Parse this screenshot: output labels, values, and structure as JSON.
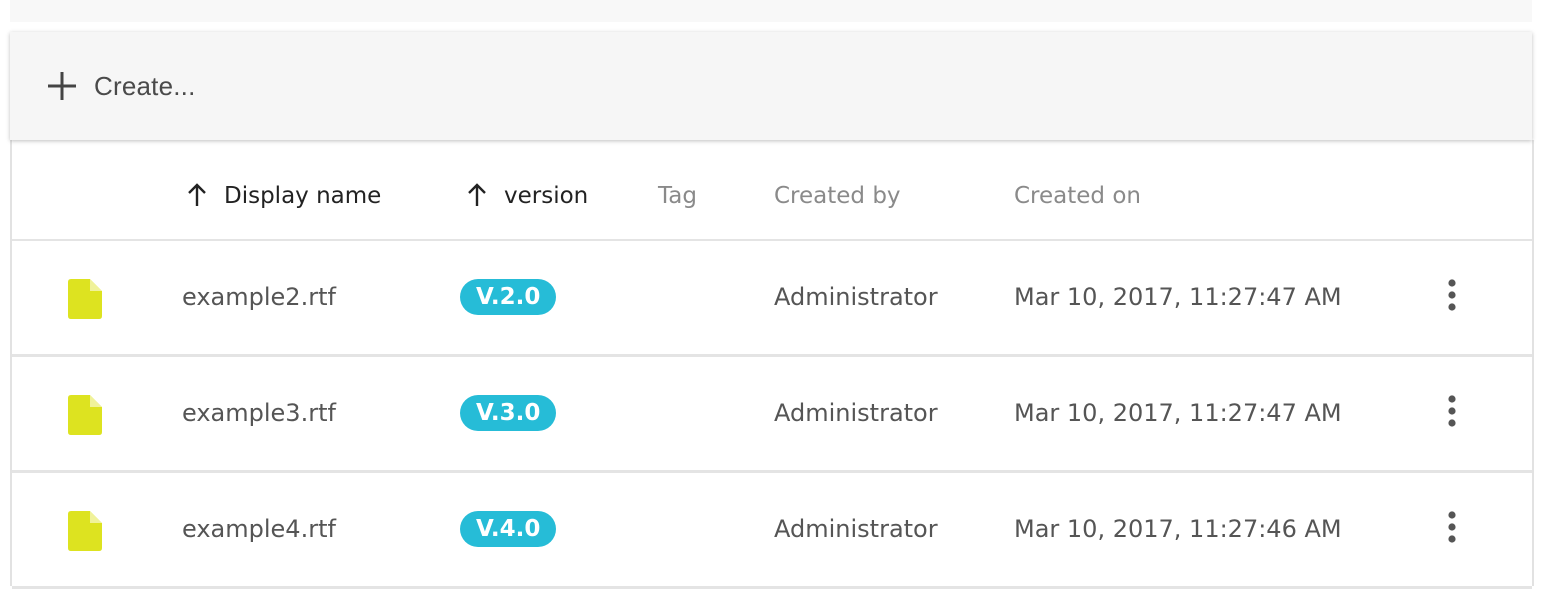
{
  "toolbar": {
    "create_label": "Create...",
    "create_icon": "plus-icon"
  },
  "table": {
    "columns": [
      {
        "label": "Display name",
        "sort_icon": "arrow-up-icon",
        "sorted": true
      },
      {
        "label": "version",
        "sort_icon": "arrow-up-icon",
        "sorted": true
      },
      {
        "label": "Tag",
        "sorted": false
      },
      {
        "label": "Created by",
        "sorted": false
      },
      {
        "label": "Created on",
        "sorted": false
      }
    ],
    "rows": [
      {
        "icon": "file-icon",
        "name": "example2.rtf",
        "version": "V.2.0",
        "tag": "",
        "created_by": "Administrator",
        "created_on": "Mar 10, 2017, 11:27:47 AM",
        "menu_icon": "more-vert-icon"
      },
      {
        "icon": "file-icon",
        "name": "example3.rtf",
        "version": "V.3.0",
        "tag": "",
        "created_by": "Administrator",
        "created_on": "Mar 10, 2017, 11:27:47 AM",
        "menu_icon": "more-vert-icon"
      },
      {
        "icon": "file-icon",
        "name": "example4.rtf",
        "version": "V.4.0",
        "tag": "",
        "created_by": "Administrator",
        "created_on": "Mar 10, 2017, 11:27:46 AM",
        "menu_icon": "more-vert-icon"
      }
    ]
  },
  "colors": {
    "badge": "#26bcd7",
    "file_icon": "#dde320",
    "toolbar_bg": "#f6f6f6",
    "sorted_header": "#222222",
    "unsorted_header": "#8a8a8a"
  }
}
